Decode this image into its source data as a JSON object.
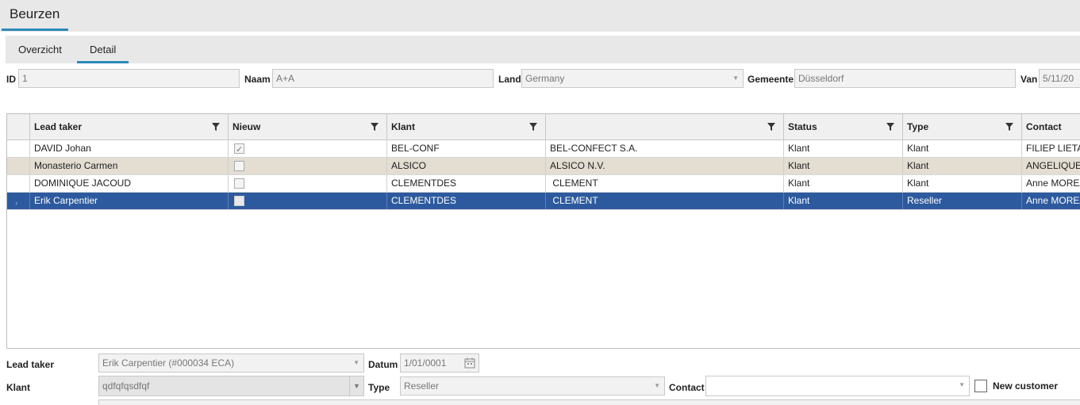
{
  "app": {
    "title": "Beurzen"
  },
  "tabs": [
    {
      "label": "Overzicht"
    },
    {
      "label": "Detail"
    }
  ],
  "top_form": {
    "id_label": "ID",
    "id_value": "1",
    "naam_label": "Naam",
    "naam_value": "A+A",
    "land_label": "Land",
    "land_value": "Germany",
    "gemeente_label": "Gemeente",
    "gemeente_value": "Düsseldorf",
    "van_label": "Van",
    "van_value": "5/11/20"
  },
  "grid": {
    "columns": [
      {
        "label": "Lead taker",
        "filter": true
      },
      {
        "label": "Nieuw",
        "filter": true
      },
      {
        "label": "Klant",
        "filter": true
      },
      {
        "label": "",
        "filter": true
      },
      {
        "label": "Status",
        "filter": true
      },
      {
        "label": "Type",
        "filter": true
      },
      {
        "label": "Contact",
        "filter": false
      }
    ],
    "rows": [
      {
        "lead": "DAVID Johan",
        "nieuw": true,
        "klant": "BEL-CONF",
        "name": "BEL-CONFECT S.A.",
        "status": "Klant",
        "type": "Klant",
        "contact": "FILIEP LIETAERT",
        "state": "normal"
      },
      {
        "lead": "Monasterio Carmen",
        "nieuw": false,
        "klant": "ALSICO",
        "name": "ALSICO N.V.",
        "status": "Klant",
        "type": "Klant",
        "contact": "ANGELIQUE V",
        "state": "alt"
      },
      {
        "lead": "DOMINIQUE JACOUD",
        "nieuw": false,
        "klant": "CLEMENTDES",
        "name": " CLEMENT",
        "status": "Klant",
        "type": "Klant",
        "contact": "Anne MOREAU",
        "state": "normal"
      },
      {
        "lead": "Erik Carpentier",
        "nieuw": false,
        "klant": "CLEMENTDES",
        "name": " CLEMENT",
        "status": "Klant",
        "type": "Reseller",
        "contact": "Anne MOREAU",
        "state": "selected"
      }
    ]
  },
  "bottom_form": {
    "lead_taker_label": "Lead taker",
    "lead_taker_value": "Erik Carpentier  (#000034 ECA)",
    "datum_label": "Datum",
    "datum_value": "1/01/0001",
    "klant_label": "Klant",
    "klant_value": "qdfqfqsdfqf",
    "type_label": "Type",
    "type_value": "Reseller",
    "contact_label": "Contact",
    "contact_value": "",
    "new_customer_label": "New customer",
    "new_customer_checked": false
  },
  "colors": {
    "accent": "#2b8ab8",
    "selected_row": "#2d5a9e",
    "alt_row": "#e3ddd2"
  },
  "icons": {
    "filter": "funnel-icon",
    "dropdown": "chevron-down-icon",
    "calendar": "calendar-icon"
  }
}
